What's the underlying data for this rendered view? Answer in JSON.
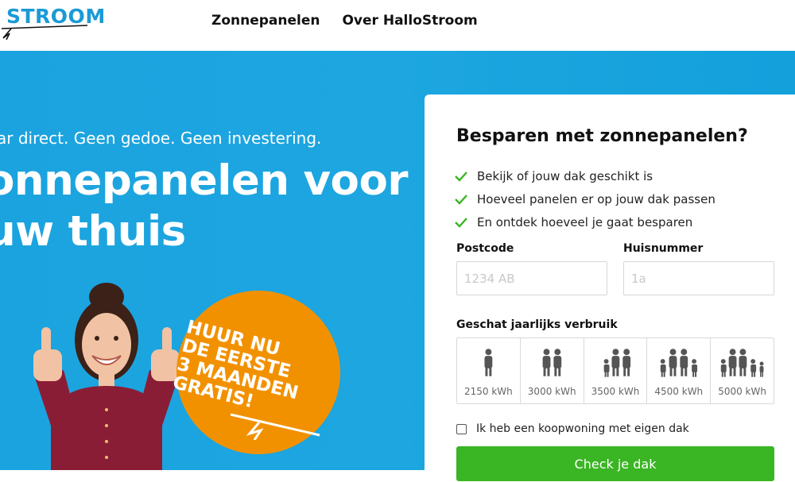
{
  "header": {
    "logo_text": "STROOM",
    "nav": [
      "Zonnepanelen",
      "Over HalloStroom"
    ]
  },
  "hero": {
    "tagline": "ar direct. Geen gedoe. Geen investering.",
    "title_line1": "onnepanelen voor",
    "title_line2": "uw thuis",
    "badge_text": "Huur nu\nde eerste\n3 maanden\ngratis!"
  },
  "form": {
    "title": "Besparen met zonnepanelen?",
    "checks": [
      "Bekijk of jouw dak geschikt is",
      "Hoeveel panelen er op jouw dak passen",
      "En ontdek hoeveel je gaat besparen"
    ],
    "postcode_label": "Postcode",
    "postcode_placeholder": "1234 AB",
    "huisnummer_label": "Huisnummer",
    "huisnummer_placeholder": "1a",
    "usage_label": "Geschat jaarlijks verbruik",
    "usage_options": [
      {
        "kwh": "2150 kWh",
        "persons": 1
      },
      {
        "kwh": "3000 kWh",
        "persons": 2
      },
      {
        "kwh": "3500 kWh",
        "persons": 3
      },
      {
        "kwh": "4500 kWh",
        "persons": 4
      },
      {
        "kwh": "5000 kWh",
        "persons": 5
      }
    ],
    "koop_label": "Ik heb een koopwoning met eigen dak",
    "cta_label": "Check je dak"
  },
  "colors": {
    "brand_blue": "#1ba3df",
    "badge_orange": "#f29100",
    "cta_green": "#3ab523",
    "check_green": "#3ab523"
  }
}
